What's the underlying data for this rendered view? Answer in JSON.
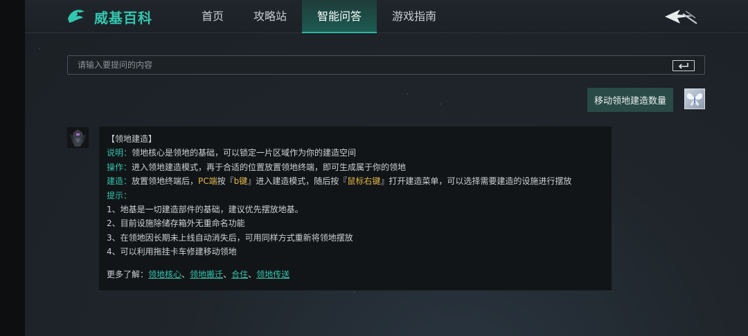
{
  "nav": {
    "brand": "威基百科",
    "tabs": [
      {
        "label": "首页",
        "active": false
      },
      {
        "label": "攻略站",
        "active": false
      },
      {
        "label": "智能问答",
        "active": true
      },
      {
        "label": "游戏指南",
        "active": false
      }
    ]
  },
  "search": {
    "placeholder": "请输入要提问的内容",
    "value": ""
  },
  "user_message": "移动领地建造数量",
  "answer": {
    "title": "【领地建造】",
    "desc_label": "说明：",
    "desc_text": "领地核心是领地的基础，可以锁定一片区域作为你的建造空间",
    "op_label": "操作：",
    "op_text": "进入领地建造模式，再于合适的位置放置领地终端，即可生成属于你的领地",
    "build_label": "建造：",
    "build_part1": "放置领地终端后，",
    "build_pc": "PC端",
    "build_part2": "按『",
    "build_key1": "b键",
    "build_part3": "』进入建造模式，随后按『",
    "build_key2": "鼠标右键",
    "build_part4": "』打开建造菜单，可以选择需要建造的设施进行摆放",
    "tips_label": "提示：",
    "tips": [
      "1、地基是一切建造部件的基础，建议优先摆放地基。",
      "2、目前设施除储存箱外无重命名功能",
      "3、在领地因长期未上线自动消失后，可用同样方式重新将领地摆放",
      "4、可以利用拖挂卡车修建移动领地"
    ],
    "more_label": "更多了解：",
    "links": [
      "领地核心",
      "领地搬迁",
      "合住",
      "领地传送"
    ],
    "link_sep": "、"
  },
  "colors": {
    "accent": "#35c2ae",
    "highlight": "#e2b74a",
    "active_tab": "#1c5a52",
    "user_bubble": "#2a4a46"
  },
  "icons": {
    "logo": "brand-logo-icon",
    "back": "back-arrow-icon",
    "enter": "enter-icon",
    "user_avatar": "butterfly-avatar-icon",
    "bot_avatar": "robot-avatar-icon"
  }
}
